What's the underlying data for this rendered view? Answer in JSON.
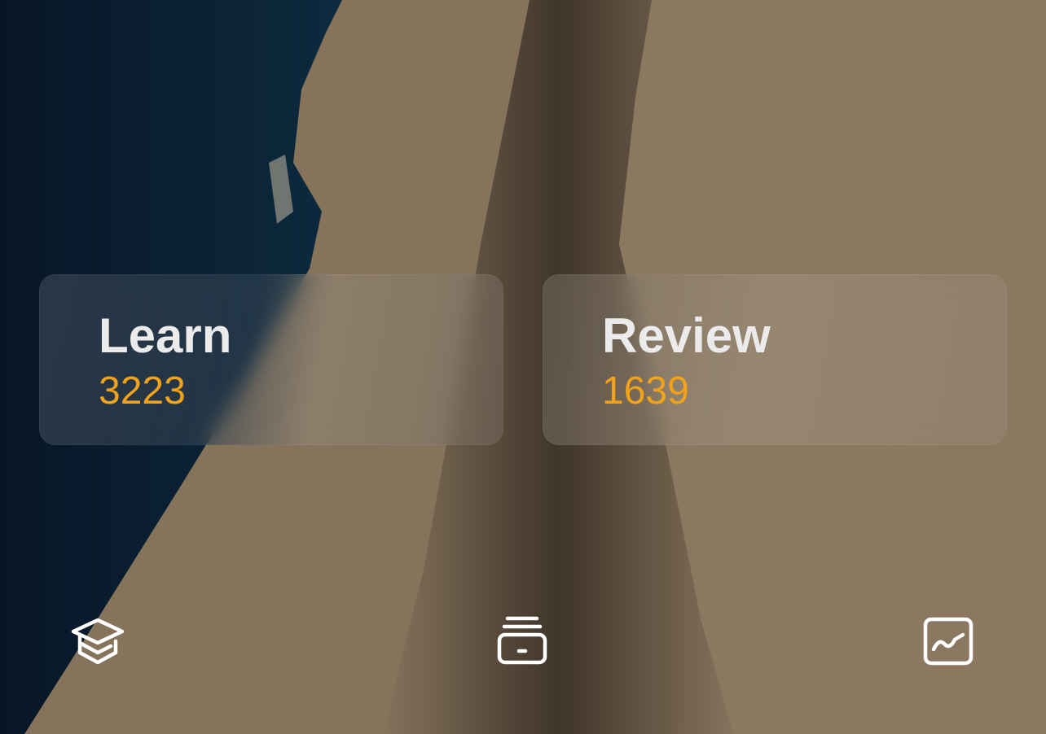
{
  "cards": {
    "learn": {
      "label": "Learn",
      "count": "3223"
    },
    "review": {
      "label": "Review",
      "count": "1639"
    }
  },
  "nav": {
    "items": [
      {
        "icon": "graduation-cap-icon"
      },
      {
        "icon": "archive-box-icon"
      },
      {
        "icon": "chart-line-icon"
      }
    ]
  },
  "colors": {
    "title": "#ebebeb",
    "count": "#f0a31a",
    "icon": "#ffffff"
  }
}
